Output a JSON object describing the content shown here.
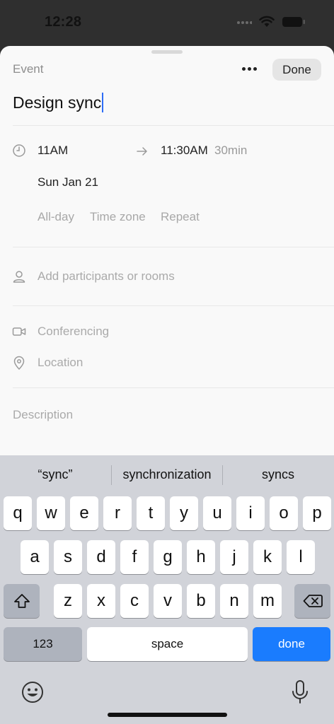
{
  "status": {
    "time": "12:28"
  },
  "sheet": {
    "header_label": "Event",
    "done_label": "Done",
    "title_value": "Design sync",
    "time": {
      "start": "11AM",
      "end": "11:30AM",
      "duration": "30min",
      "date": "Sun Jan 21"
    },
    "options": [
      "All-day",
      "Time zone",
      "Repeat"
    ],
    "participants_placeholder": "Add participants or rooms",
    "conferencing_placeholder": "Conferencing",
    "location_placeholder": "Location",
    "description_placeholder": "Description"
  },
  "keyboard": {
    "suggestions": [
      "“sync”",
      "synchronization",
      "syncs"
    ],
    "row1": [
      "q",
      "w",
      "e",
      "r",
      "t",
      "y",
      "u",
      "i",
      "o",
      "p"
    ],
    "row2": [
      "a",
      "s",
      "d",
      "f",
      "g",
      "h",
      "j",
      "k",
      "l"
    ],
    "row3": [
      "z",
      "x",
      "c",
      "v",
      "b",
      "n",
      "m"
    ],
    "numbers_label": "123",
    "space_label": "space",
    "return_label": "done"
  },
  "colors": {
    "accent": "#1a7cfe",
    "caret": "#2e6df6"
  }
}
